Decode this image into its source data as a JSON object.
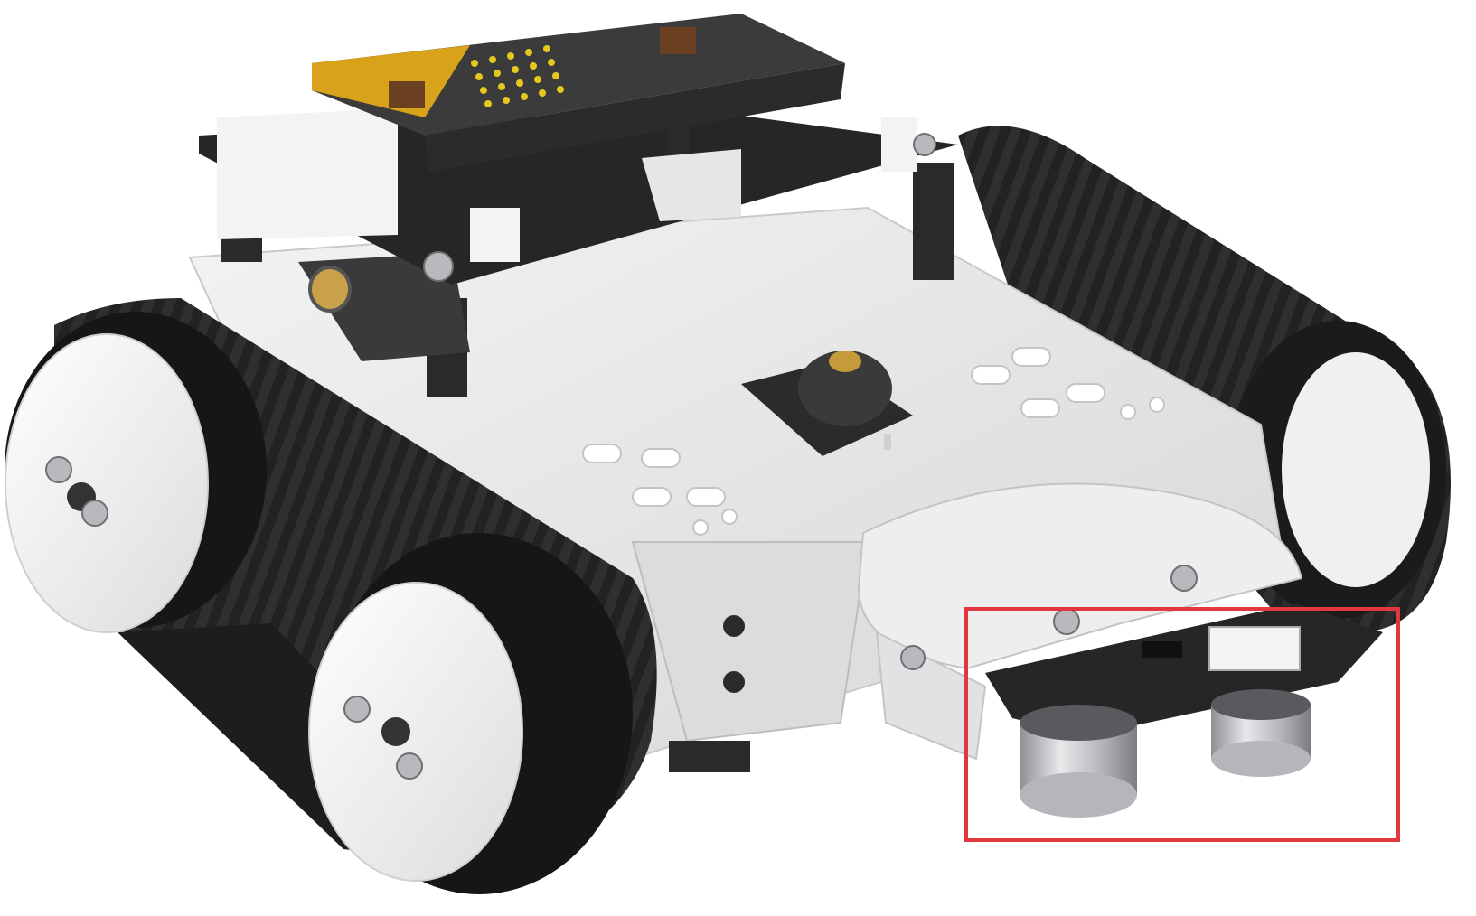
{
  "image": {
    "subject": "tracked-robot-car",
    "highlight": {
      "target": "ultrasonic-sensor-module",
      "color": "#e0383e"
    }
  },
  "colors": {
    "chassis": "#e9e9ea",
    "track": "#1e1e1e",
    "wheel_cap": "#f2f2f2",
    "board": "#2b2b2b",
    "microbit": "#3a3a3a",
    "microbit_accent": "#d8a21a",
    "led": "#e4c81d",
    "sensor_can": "#c8c8cc",
    "connector": "#f4f4f4"
  }
}
